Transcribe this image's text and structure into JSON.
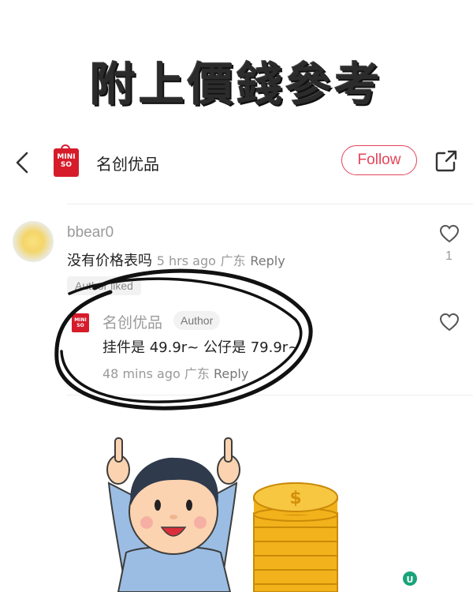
{
  "banner": {
    "title": "附上價錢參考"
  },
  "header": {
    "back_icon": "chevron-left-icon",
    "brand_logo_lines": [
      "MINI",
      "SO"
    ],
    "shop_name": "名创优品",
    "follow_label": "Follow",
    "share_icon": "share-out-icon"
  },
  "comments": [
    {
      "username": "bbear0",
      "text": "没有价格表吗",
      "time": "5 hrs ago",
      "location": "广东",
      "reply_label": "Reply",
      "like_count": "1",
      "badge": "Author liked"
    }
  ],
  "reply": {
    "username": "名创优品",
    "tag": "Author",
    "text": "挂件是 49.9r~ 公仔是 79.9r~",
    "time": "48 mins ago",
    "location": "广东",
    "reply_label": "Reply"
  },
  "colors": {
    "brand_red": "#d61b2a",
    "follow_pink": "#e5445a",
    "annotation_black": "#111111",
    "coin_gold": "#f2b21b"
  }
}
